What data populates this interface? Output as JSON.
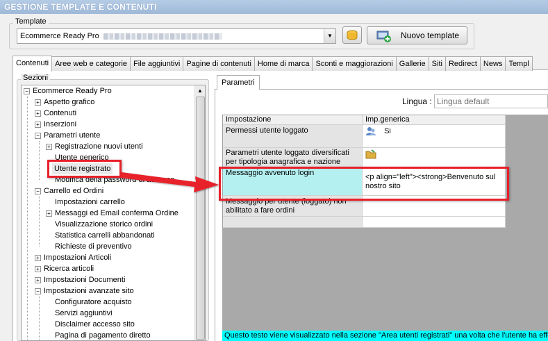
{
  "window": {
    "title": "GESTIONE TEMPLATE E CONTENUTI"
  },
  "template_group": {
    "label": "Template",
    "selected": "Ecommerce Ready Pro",
    "new_button": "Nuovo template"
  },
  "tabs": [
    {
      "label": "Contenuti",
      "active": true
    },
    {
      "label": "Aree web e categorie"
    },
    {
      "label": "File aggiuntivi"
    },
    {
      "label": "Pagine di contenuti"
    },
    {
      "label": "Home di marca"
    },
    {
      "label": "Sconti e maggiorazioni"
    },
    {
      "label": "Gallerie"
    },
    {
      "label": "Siti"
    },
    {
      "label": "Redirect"
    },
    {
      "label": "News"
    },
    {
      "label": "Templ"
    }
  ],
  "sections": {
    "label": "Sezioni",
    "items": [
      {
        "label": "Ecommerce Ready Pro",
        "expander": "minus"
      },
      {
        "label": "Aspetto grafico",
        "expander": "plus"
      },
      {
        "label": "Contenuti",
        "expander": "plus"
      },
      {
        "label": "Inserzioni",
        "expander": "plus"
      },
      {
        "label": "Parametri utente",
        "expander": "minus"
      },
      {
        "label": "Registrazione nuovi utenti",
        "expander": "plus"
      },
      {
        "label": "Utente generico",
        "expander": ""
      },
      {
        "label": "Utente registrato",
        "expander": ""
      },
      {
        "label": "Modifica della password di accesso",
        "expander": ""
      },
      {
        "label": "Carrello ed Ordini",
        "expander": "minus"
      },
      {
        "label": "Impostazioni carrello",
        "expander": ""
      },
      {
        "label": "Messaggi ed Email conferma Ordine",
        "expander": "plus"
      },
      {
        "label": "Visualizzazione storico ordini",
        "expander": ""
      },
      {
        "label": "Statistica carrelli abbandonati",
        "expander": ""
      },
      {
        "label": "Richieste di preventivo",
        "expander": ""
      },
      {
        "label": "Impostazioni Articoli",
        "expander": "plus"
      },
      {
        "label": "Ricerca articoli",
        "expander": "plus"
      },
      {
        "label": "Impostazioni Documenti",
        "expander": "plus"
      },
      {
        "label": "Impostazioni avanzate sito",
        "expander": "minus"
      },
      {
        "label": "Configuratore acquisto",
        "expander": ""
      },
      {
        "label": "Servizi aggiuntivi",
        "expander": ""
      },
      {
        "label": "Disclaimer accesso sito",
        "expander": ""
      },
      {
        "label": "Pagina di pagamento diretto",
        "expander": ""
      }
    ]
  },
  "params": {
    "tab_label": "Parametri",
    "lingua_label": "Lingua :",
    "lingua_value": "Lingua default",
    "columns": [
      "Impostazione",
      "Imp.generica"
    ],
    "rows": [
      {
        "setting": "Permessi utente loggato",
        "value": "Si"
      },
      {
        "setting": "Parametri utente loggato diversificati per tipologia anagrafica e nazione",
        "value": ""
      },
      {
        "setting": "Messaggio avvenuto login",
        "value": "<p align=\"left\"><strong>Benvenuto sul nostro sito"
      },
      {
        "setting": "Messaggio per utente (loggato) non abilitato a fare ordini",
        "value": ""
      },
      {
        "setting": "",
        "value": ""
      }
    ]
  },
  "status": {
    "text": "Questo testo viene visualizzato nella sezione \"Area utenti registrati\" una volta che l'utente ha effe"
  },
  "colors": {
    "highlight": "#e8202a",
    "selected_row": "#b4f0f0",
    "status_bg": "#00ffff"
  }
}
